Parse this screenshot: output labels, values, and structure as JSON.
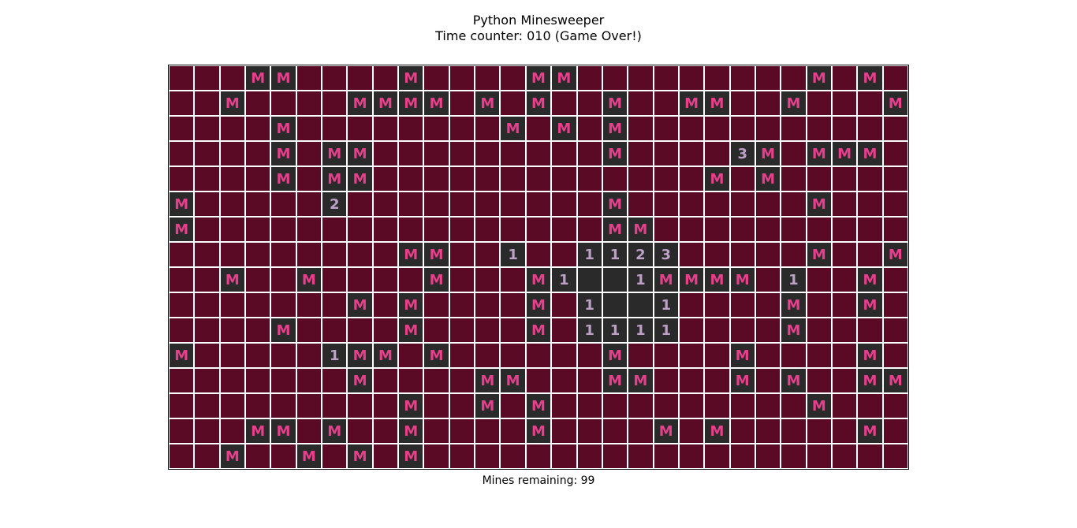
{
  "title_line1": "Python Minesweeper",
  "title_line2": "Time counter: 010 (Game Over!)",
  "footer_label": "Mines remaining: 99",
  "colors": {
    "covered": "#5b0a25",
    "mine_bg": "#2a2a2a",
    "mine_fg": "#e83e8c",
    "num_bg": "#2a2a2a",
    "num_fg": "#bda0c6",
    "grid_line": "#ffffff"
  },
  "board": {
    "cols": 29,
    "rows": 16,
    "mine_glyph": "M",
    "legend": ". = covered, M = revealed mine, digit = revealed number, _ = revealed empty",
    "grid": [
      "...MM....M....MM.........M.M.",
      "..M....MMMM.M.M..M..MM..M...M",
      "....M........M.M.M...........",
      "....M.MM.........M....3M.MMM.",
      "....M.MM.............M.M.....",
      "M.....2..........M.......M...",
      "M................MM..........",
      ".........MM..1..1123.....M..M",
      "..M..M....M...M1__1MMMM.1..M.",
      ".......M.M....M.1__1....M..M.",
      "....M....M....M.1111....M....",
      "M.....1MM.M......M....M....M.",
      ".......M....MM...MM...M.M..MM",
      ".........M..M.M..........M...",
      "...MM.M..M....M....M.M.....M.",
      "..M..M.M.M..................."
    ]
  }
}
